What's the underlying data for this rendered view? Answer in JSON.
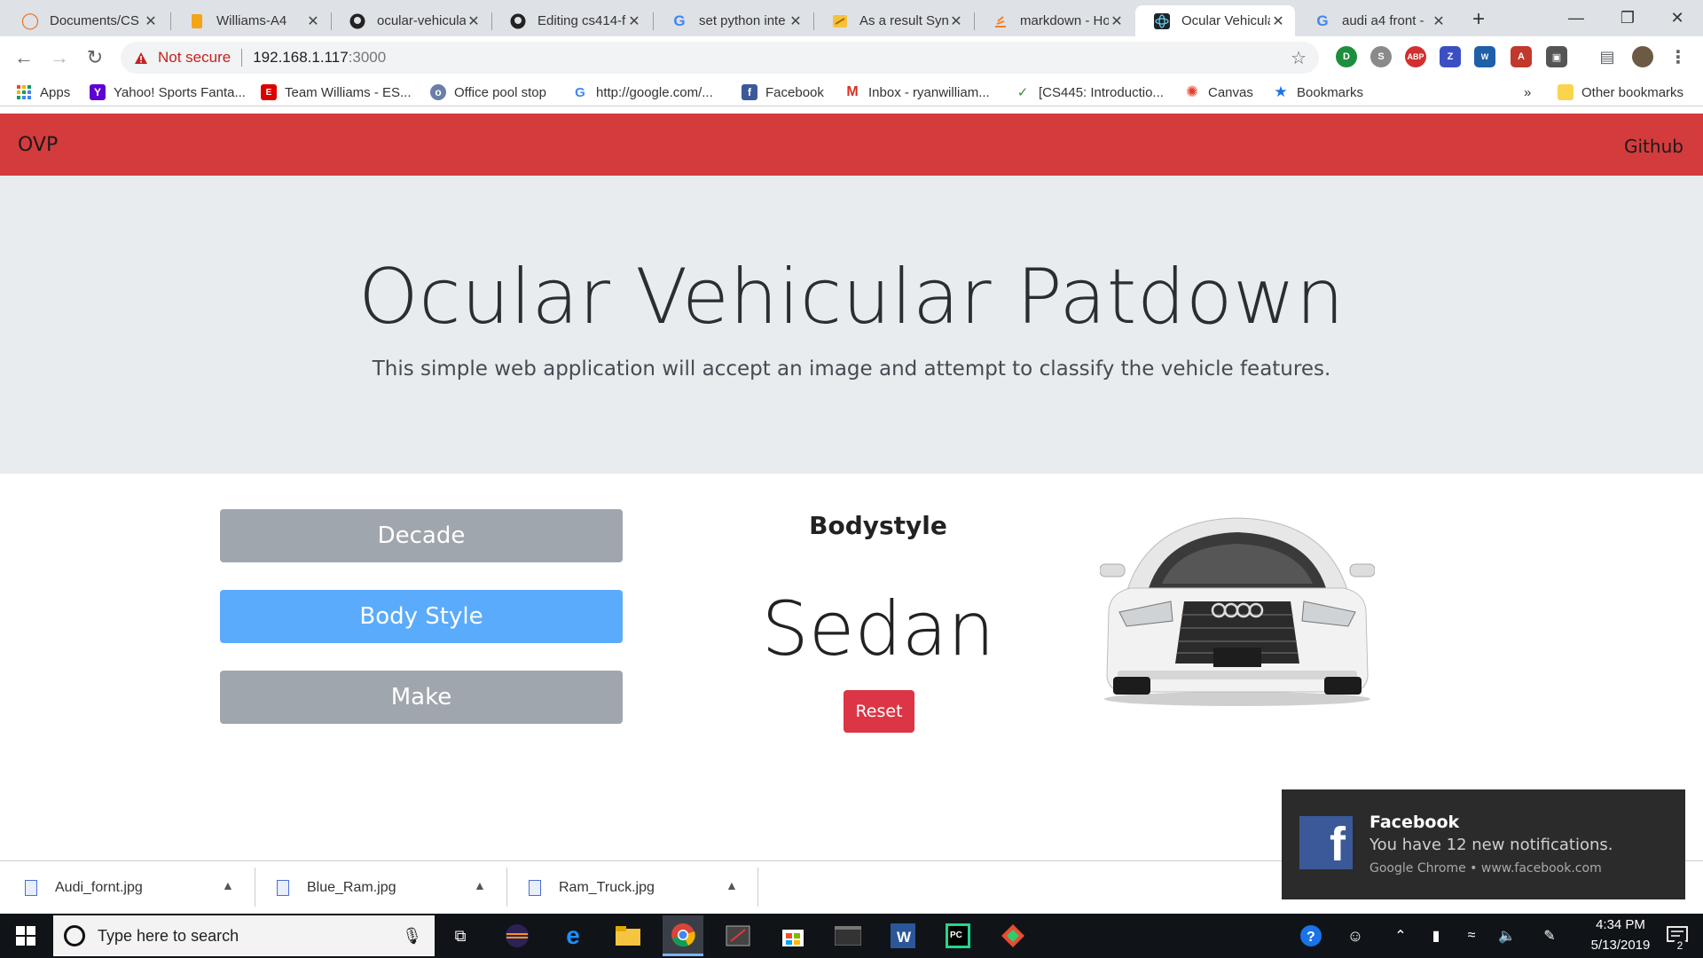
{
  "browser": {
    "tabs": [
      {
        "title": "Documents/CS",
        "icon": "cloud-icon"
      },
      {
        "title": "Williams-A4",
        "icon": "slides-icon"
      },
      {
        "title": "ocular-vehicula",
        "icon": "github-icon"
      },
      {
        "title": "Editing cs414-f",
        "icon": "github-icon"
      },
      {
        "title": "set python inte",
        "icon": "google-icon"
      },
      {
        "title": "As a result Sync",
        "icon": "stackoverflow-icon"
      },
      {
        "title": "markdown - Ho",
        "icon": "stackoverflow-icon"
      },
      {
        "title": "Ocular Vehicula",
        "icon": "react-icon"
      },
      {
        "title": "audi a4 front -",
        "icon": "google-icon"
      }
    ],
    "new_tab": "+",
    "security_label": "Not secure",
    "url_host": "192.168.1.117",
    "url_port": ":3000",
    "bookmarks": [
      "Apps",
      "Yahoo! Sports Fanta...",
      "Team Williams - ES...",
      "Office pool stop",
      "http://google.com/...",
      "Facebook",
      "Inbox - ryanwilliam...",
      "[CS445: Introductio...",
      "Canvas",
      "Bookmarks"
    ],
    "overflow": "»",
    "other_bookmarks": "Other bookmarks"
  },
  "page": {
    "brand": "OVP",
    "nav_link": "Github",
    "title": "Ocular Vehicular Patdown",
    "lead": "This simple web application will accept an image and attempt to classify the vehicle features.",
    "buttons": [
      "Decade",
      "Body Style",
      "Make"
    ],
    "active_button": "Body Style",
    "result_label": "Bodystyle",
    "result_value": "Sedan",
    "reset_label": "Reset",
    "colors": {
      "navbar": "#d43b3d",
      "active": "#5aabfc",
      "inactive": "#a0a6ad",
      "reset": "#dc3545"
    }
  },
  "downloads": [
    "Audi_fornt.jpg",
    "Blue_Ram.jpg",
    "Ram_Truck.jpg"
  ],
  "notification": {
    "app": "Facebook",
    "message": "You have 12 new notifications.",
    "source": "Google Chrome • www.facebook.com"
  },
  "taskbar": {
    "search_placeholder": "Type here to search",
    "time": "4:34 PM",
    "date": "5/13/2019",
    "notification_count": "2"
  }
}
